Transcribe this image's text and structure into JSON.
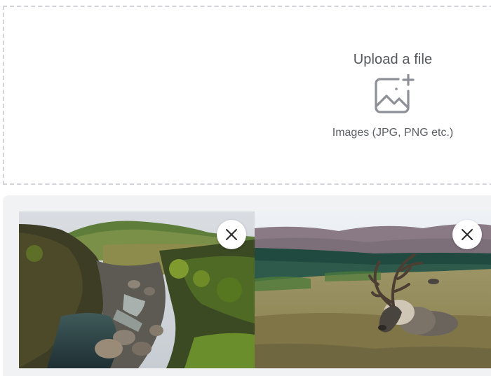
{
  "upload": {
    "title": "Upload a file",
    "hint": "Images (JPG, PNG etc.)",
    "icon": "image-add-icon"
  },
  "previews": [
    {
      "name": "image-preview-1",
      "description_icon": "close-icon"
    },
    {
      "name": "image-preview-2",
      "description_icon": "close-icon"
    }
  ],
  "colors": {
    "dashed_border": "#d2d4d7",
    "tray_bg": "#f1f2f3",
    "text": "#54575c",
    "icon": "#8d9096"
  }
}
